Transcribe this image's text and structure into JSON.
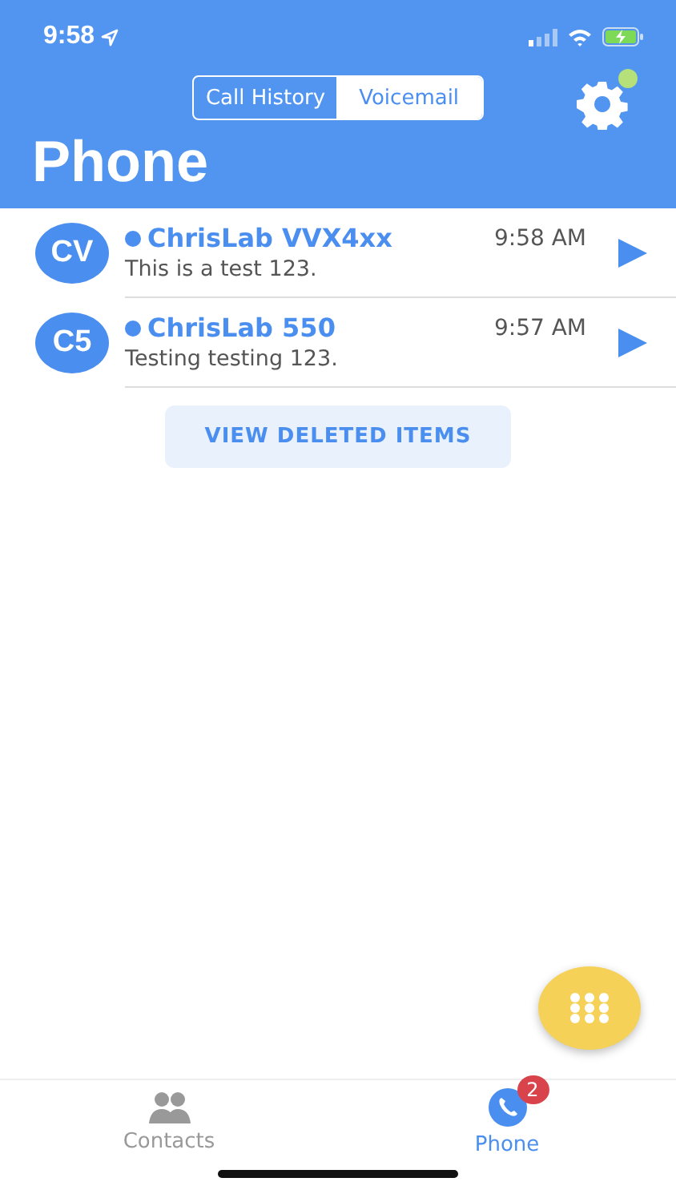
{
  "status_bar": {
    "time": "9:58"
  },
  "segments": [
    {
      "label": "Call History",
      "selected": false
    },
    {
      "label": "Voicemail",
      "selected": true
    }
  ],
  "settings": {
    "notification": true
  },
  "title": "Phone",
  "voicemails": [
    {
      "initials": "CV",
      "name": "ChrisLab VVX4xx",
      "time": "9:58 AM",
      "message": "This is a test 123.",
      "unread": true
    },
    {
      "initials": "C5",
      "name": "ChrisLab 550",
      "time": "9:57 AM",
      "message": "Testing testing 123.",
      "unread": true
    }
  ],
  "deleted_button": "VIEW DELETED ITEMS",
  "tab_bar": [
    {
      "label": "Contacts",
      "kind": "contacts",
      "selected": false
    },
    {
      "label": "Phone",
      "kind": "phone",
      "selected": true,
      "badge": "2"
    }
  ]
}
